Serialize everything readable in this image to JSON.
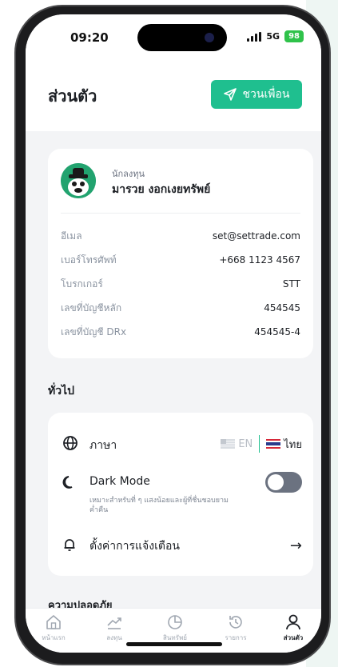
{
  "status_bar": {
    "time": "09:20",
    "network": "5G",
    "battery": "98"
  },
  "header": {
    "title": "ส่วนตัว",
    "invite_label": "ชวนเพื่อน"
  },
  "profile": {
    "role": "นักลงทุน",
    "name": "มารวย งอกเงยทรัพย์",
    "fields": [
      {
        "label": "อีเมล",
        "value": "set@settrade.com"
      },
      {
        "label": "เบอร์โทรศัพท์",
        "value": "+668 1123 4567"
      },
      {
        "label": "โบรกเกอร์",
        "value": "STT"
      },
      {
        "label": "เลขที่บัญชีหลัก",
        "value": "454545"
      },
      {
        "label": "เลขที่บัญชี DRx",
        "value": "454545-4"
      }
    ]
  },
  "general": {
    "title": "ทั่วไป",
    "language": {
      "label": "ภาษา",
      "en": "EN",
      "th": "ไทย"
    },
    "dark_mode": {
      "label": "Dark Mode",
      "description": "เหมาะสำหรับที่ ๆ แสงน้อยและผู้ที่ชื่นชอบยามค่ำคืน",
      "enabled": false
    },
    "notifications": {
      "label": "ตั้งค่าการแจ้งเตือน"
    }
  },
  "next_section": {
    "title": "ความปลอดภัย"
  },
  "tabbar": {
    "items": [
      {
        "label": "หน้าแรก",
        "icon": "home-icon"
      },
      {
        "label": "ลงทุน",
        "icon": "trend-icon"
      },
      {
        "label": "สินทรัพย์",
        "icon": "pie-icon"
      },
      {
        "label": "รายการ",
        "icon": "history-icon"
      },
      {
        "label": "ส่วนตัว",
        "icon": "person-icon"
      }
    ],
    "active": "ส่วนตัว"
  },
  "colors": {
    "accent": "#1fbf8f",
    "background": "#f3f4f6"
  }
}
